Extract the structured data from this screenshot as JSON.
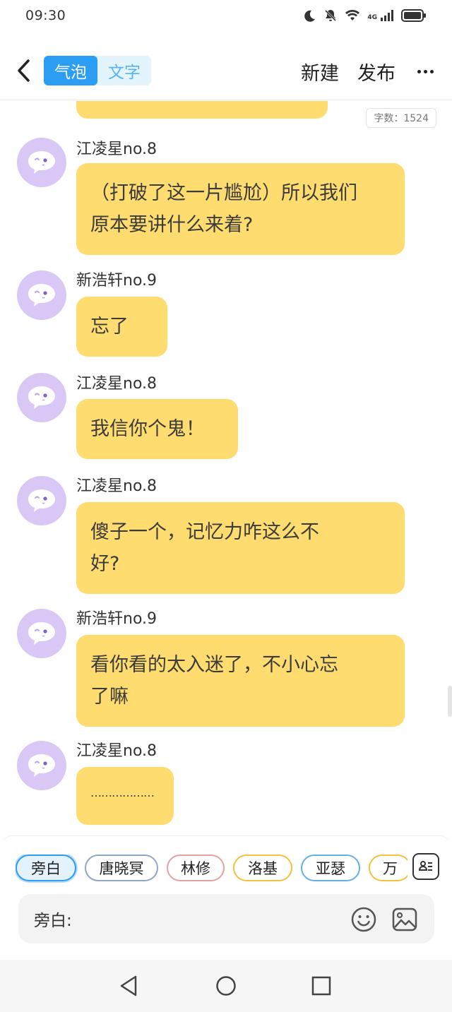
{
  "status_bar": {
    "time": "09:30",
    "network_label": "4G"
  },
  "header": {
    "back_icon": "chevron-left-icon",
    "mode_tabs": [
      {
        "label": "气泡",
        "active": true
      },
      {
        "label": "文字",
        "active": false
      }
    ],
    "actions": {
      "new_label": "新建",
      "publish_label": "发布",
      "more_icon": "more-horizontal-icon"
    }
  },
  "word_count": "字数：1524",
  "messages": [
    {
      "name": "江凌星no.8",
      "lines": [
        "（打破了这一片尴尬）所以我们",
        "原本要讲什么来着?"
      ]
    },
    {
      "name": "新浩轩no.9",
      "lines": [
        "忘了"
      ]
    },
    {
      "name": "江凌星no.8",
      "lines": [
        "我信你个鬼！"
      ]
    },
    {
      "name": "江凌星no.8",
      "lines": [
        "傻子一个，记忆力咋这么不",
        "好?"
      ]
    },
    {
      "name": "新浩轩no.9",
      "lines": [
        "看你看的太入迷了，不小心忘",
        "了嘛"
      ]
    },
    {
      "name": "江凌星no.8",
      "lines": [
        "………………"
      ]
    }
  ],
  "roles": [
    {
      "label": "旁白",
      "color": "#2b9ef4",
      "selected": true
    },
    {
      "label": "唐晓冥",
      "color": "#8fa6c4",
      "selected": false
    },
    {
      "label": "林修",
      "color": "#e3a2a2",
      "selected": false
    },
    {
      "label": "洛基",
      "color": "#f2c13d",
      "selected": false
    },
    {
      "label": "亚瑟",
      "color": "#62b0e8",
      "selected": false
    },
    {
      "label": "万",
      "color": "#f2c13d",
      "selected": false
    }
  ],
  "input": {
    "prefix": "旁白:",
    "emoji_icon": "smiley-icon",
    "image_icon": "image-icon"
  },
  "colors": {
    "accent": "#2b9ef4",
    "bubble": "#fedc6f",
    "avatar": "#d9c8f6"
  }
}
